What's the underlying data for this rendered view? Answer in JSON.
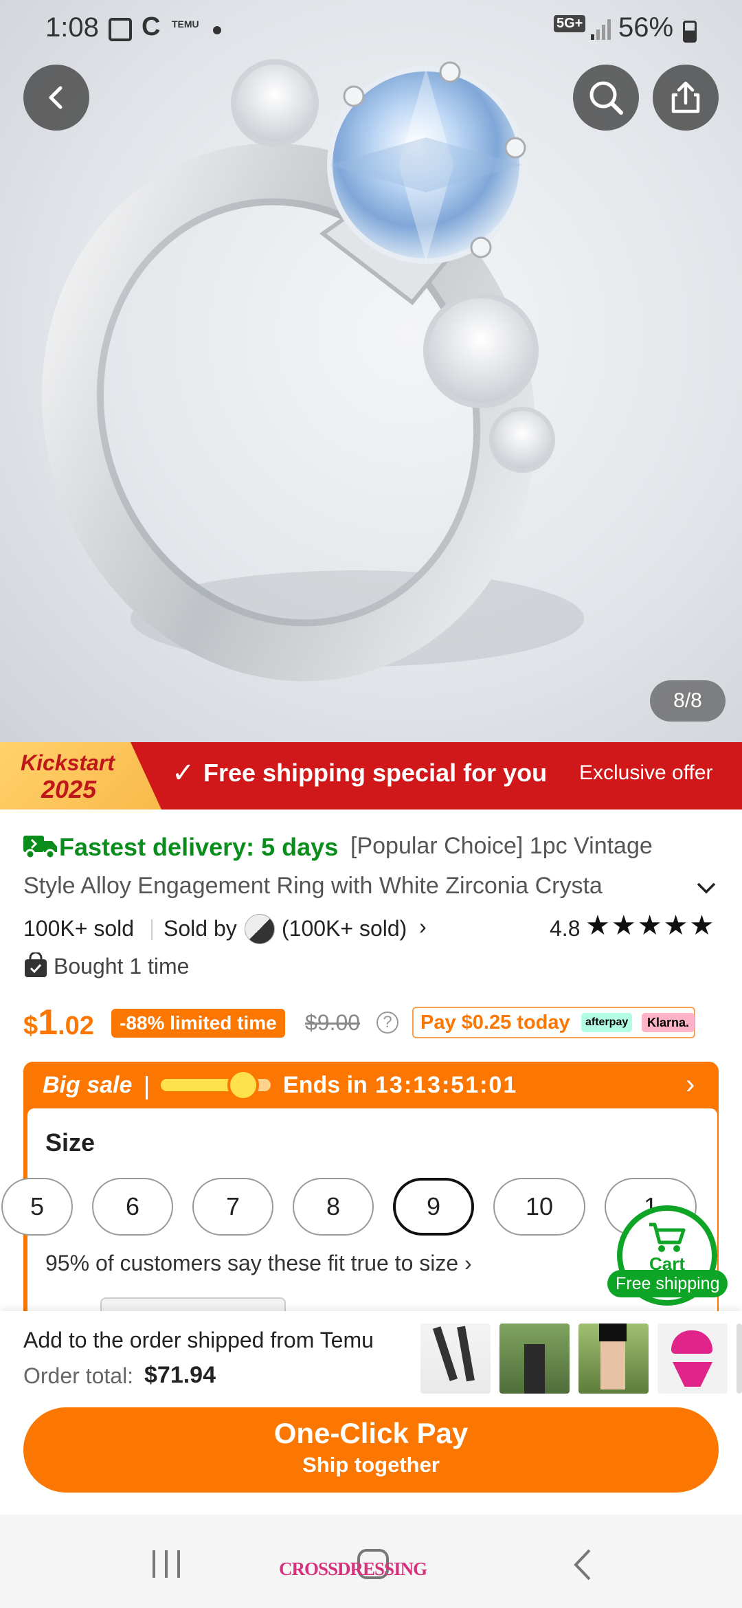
{
  "status_bar": {
    "time": "1:08",
    "app_badge": "TEMU",
    "network": "5G+",
    "battery": "56%"
  },
  "hero": {
    "image_counter": "8/8",
    "icons": [
      "back-icon",
      "search-icon",
      "share-icon"
    ]
  },
  "promo_banner": {
    "kickstart_top": "Kickstart",
    "kickstart_year": "2025",
    "free_shipping": "Free shipping special for you",
    "exclusive_offer": "Exclusive offer"
  },
  "product": {
    "delivery": "Fastest delivery: 5 days",
    "title_line1": "[Popular Choice] 1pc Vintage",
    "title_line2": "Style Alloy Engagement Ring with White Zirconia Crysta",
    "sold": "100K+ sold",
    "sold_by_label": "Sold by",
    "seller_sold": "(100K+ sold)",
    "rating": "4.8",
    "rating_stars": 4.8,
    "bought": "Bought 1 time",
    "price_currency": "$",
    "price_whole": "1",
    "price_cents": ".02",
    "discount_badge": "-88% limited time",
    "original_price": "$9.00",
    "pay_later": "Pay $0.25 today",
    "afterpay": "afterpay",
    "klarna": "Klarna."
  },
  "sale": {
    "label": "Big sale",
    "ends_label": "Ends in",
    "countdown": "13:13:51:01",
    "progress": 0.75
  },
  "size": {
    "title": "Size",
    "options": [
      "5",
      "6",
      "7",
      "8",
      "9",
      "10",
      "1"
    ],
    "selected": "9",
    "fit_note": "95% of customers say these fit true to size"
  },
  "cart": {
    "label": "Cart",
    "free_shipping": "Free shipping"
  },
  "bottom_bar": {
    "add_to_order": "Add to the order shipped from Temu",
    "order_total_label": "Order total:",
    "order_total_value": "$71.94",
    "pay_button": "One-Click Pay",
    "pay_sub": "Ship together"
  },
  "nav_bar": {
    "overlay_text": "CROSSDRESSING"
  },
  "colors": {
    "brand_orange": "#fb7701",
    "promo_red": "#d0171a",
    "delivery_green": "#0a8d1c",
    "cart_green": "#0ea526"
  }
}
